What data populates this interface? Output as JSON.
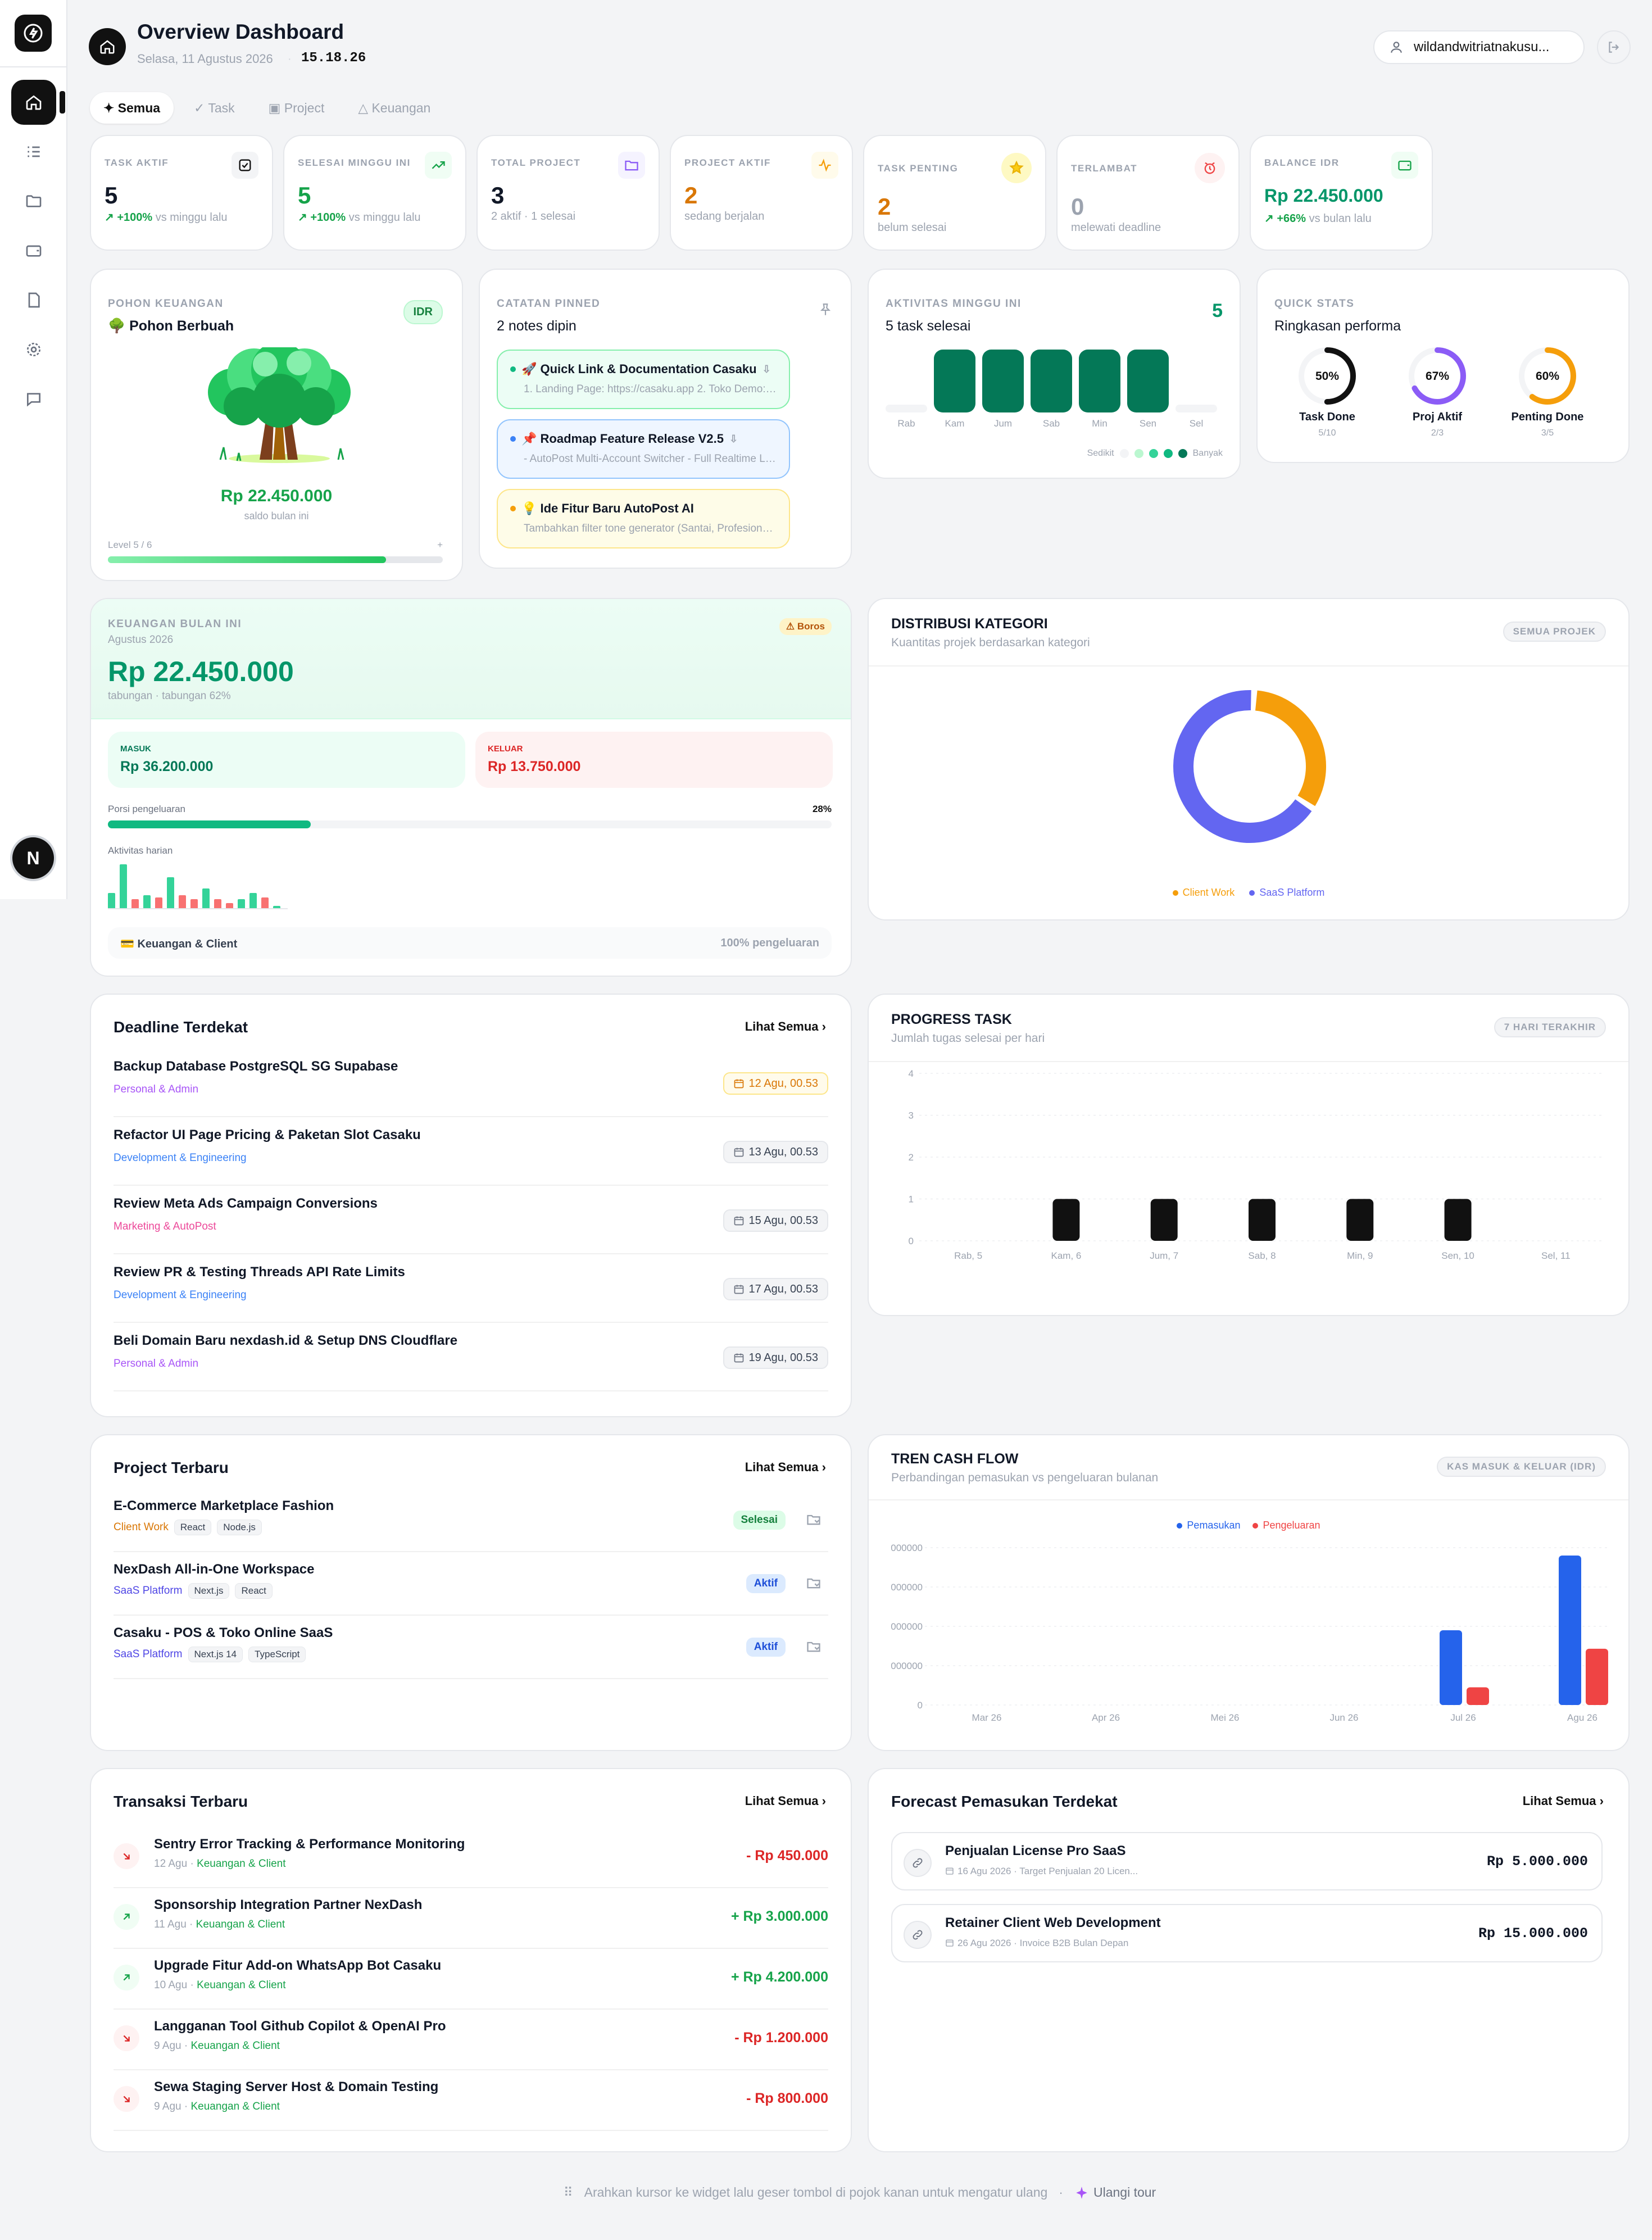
{
  "header": {
    "title": "Overview Dashboard",
    "date": "Selasa, 11 Agustus 2026",
    "time": "15.18.26",
    "user": "wildandwitriatnakusu..."
  },
  "tabs": [
    {
      "label": "✦ Semua"
    },
    {
      "label": "✓ Task"
    },
    {
      "label": "▣ Project"
    },
    {
      "label": "△ Keuangan"
    }
  ],
  "sidebar": {
    "avatar_letter": "N",
    "icons": [
      "home-icon",
      "list-icon",
      "folder-icon",
      "wallet-icon",
      "file-icon",
      "settings-icon",
      "chat-icon"
    ]
  },
  "stats": [
    {
      "label": "TASK AKTIF",
      "value": "5",
      "trend": "+100%",
      "sub": "vs minggu lalu",
      "color": "#111827"
    },
    {
      "label": "SELESAI MINGGU INI",
      "value": "5",
      "trend": "+100%",
      "sub": "vs minggu lalu",
      "color": "#16a34a"
    },
    {
      "label": "TOTAL PROJECT",
      "value": "3",
      "trend": "",
      "sub": "2 aktif · 1 selesai",
      "color": "#111827"
    },
    {
      "label": "PROJECT AKTIF",
      "value": "2",
      "trend": "",
      "sub": "sedang berjalan",
      "color": "#d97706"
    },
    {
      "label": "TASK PENTING",
      "value": "2",
      "trend": "",
      "sub": "belum selesai",
      "color": "#d97706"
    },
    {
      "label": "TERLAMBAT",
      "value": "0",
      "trend": "",
      "sub": "melewati deadline",
      "color": "#9ca3af"
    },
    {
      "label": "BALANCE IDR",
      "value": "Rp 22.450.000",
      "trend": "+66%",
      "sub": "vs bulan lalu",
      "color": "#059669"
    }
  ],
  "tree": {
    "label": "POHON KEUANGAN",
    "title": "🌳 Pohon Berbuah",
    "badge": "IDR",
    "amount": "Rp 22.450.000",
    "caption": "saldo bulan ini",
    "level": "Level 5 / 6",
    "level_pct": 0.83,
    "plus": "+"
  },
  "notes": {
    "label": "CATATAN PINNED",
    "title": "2 notes dipin",
    "items": [
      {
        "title": "🚀 Quick Link & Documentation Casaku",
        "desc": "1. Landing Page: https://casaku.app 2. Toko Demo: ..."
      },
      {
        "title": "📌 Roadmap Feature Release V2.5",
        "desc": "- AutoPost Multi-Account Switcher - Full Realtime Liv..."
      },
      {
        "title": "💡 Ide Fitur Baru AutoPost AI",
        "desc": "Tambahkan filter tone generator (Santai, Profesional, ..."
      }
    ]
  },
  "activity": {
    "label": "AKTIVITAS MINGGU INI",
    "title": "5 task selesai",
    "count": "5",
    "days": [
      {
        "label": "Rab",
        "value": 0
      },
      {
        "label": "Kam",
        "value": 1
      },
      {
        "label": "Jum",
        "value": 1
      },
      {
        "label": "Sab",
        "value": 1
      },
      {
        "label": "Min",
        "value": 1
      },
      {
        "label": "Sen",
        "value": 1
      },
      {
        "label": "Sel",
        "value": 0
      }
    ],
    "legend_low": "Sedikit",
    "legend_high": "Banyak"
  },
  "quick": {
    "label": "QUICK STATS",
    "title": "Ringkasan performa",
    "items": [
      {
        "pct": "50%",
        "value": 0.5,
        "label": "Task Done",
        "sub": "5/10",
        "color": "#111111"
      },
      {
        "pct": "67%",
        "value": 0.67,
        "label": "Proj Aktif",
        "sub": "2/3",
        "color": "#8b5cf6"
      },
      {
        "pct": "60%",
        "value": 0.6,
        "label": "Penting Done",
        "sub": "3/5",
        "color": "#f59e0b"
      }
    ]
  },
  "finance": {
    "label": "KEUANGAN BULAN INI",
    "month": "Agustus 2026",
    "badge": "⚠ Boros",
    "amount": "Rp 22.450.000",
    "sub": "tabungan · tabungan 62%",
    "in_label": "MASUK",
    "in_value": "Rp 36.200.000",
    "out_label": "KELUAR",
    "out_value": "Rp 13.750.000",
    "ratio_label": "Porsi pengeluaran",
    "ratio_pct": "28%",
    "ratio": 0.28,
    "daily_label": "Aktivitas harian",
    "daily": [
      {
        "v": 0.35,
        "t": "in"
      },
      {
        "v": 1,
        "t": "in"
      },
      {
        "v": 0.2,
        "t": "out"
      },
      {
        "v": 0.3,
        "t": "in"
      },
      {
        "v": 0.25,
        "t": "out"
      },
      {
        "v": 0.7,
        "t": "in"
      },
      {
        "v": 0.3,
        "t": "out"
      },
      {
        "v": 0.2,
        "t": "out"
      },
      {
        "v": 0.45,
        "t": "in"
      },
      {
        "v": 0.2,
        "t": "out"
      },
      {
        "v": 0.12,
        "t": "out"
      },
      {
        "v": 0.2,
        "t": "in"
      },
      {
        "v": 0.35,
        "t": "in"
      },
      {
        "v": 0.25,
        "t": "out"
      },
      {
        "v": 0.05,
        "t": "in"
      }
    ],
    "footer_left": "💳 Keuangan & Client",
    "footer_right": "100% pengeluaran"
  },
  "distribusi": {
    "title": "DISTRIBUSI KATEGORI",
    "subtitle": "Kuantitas projek berdasarkan kategori",
    "pill": "SEMUA PROJEK",
    "chart_data": {
      "type": "pie",
      "categories": [
        "Client Work",
        "SaaS Platform"
      ],
      "values": [
        1,
        2
      ],
      "colors": [
        "#f59e0b",
        "#6366f1"
      ]
    }
  },
  "deadline": {
    "title": "Deadline Terdekat",
    "link": "Lihat Semua",
    "items": [
      {
        "title": "Backup Database PostgreSQL SG Supabase",
        "cat": "Personal & Admin",
        "color": "#a855f7",
        "date": "12 Agu, 00.53",
        "urgent": true
      },
      {
        "title": "Refactor UI Page Pricing & Paketan Slot Casaku",
        "cat": "Development & Engineering",
        "color": "#3b82f6",
        "date": "13 Agu, 00.53",
        "urgent": false
      },
      {
        "title": "Review Meta Ads Campaign Conversions",
        "cat": "Marketing & AutoPost",
        "color": "#ec4899",
        "date": "15 Agu, 00.53",
        "urgent": false
      },
      {
        "title": "Review PR & Testing Threads API Rate Limits",
        "cat": "Development & Engineering",
        "color": "#3b82f6",
        "date": "17 Agu, 00.53",
        "urgent": false
      },
      {
        "title": "Beli Domain Baru nexdash.id & Setup DNS Cloudflare",
        "cat": "Personal & Admin",
        "color": "#a855f7",
        "date": "19 Agu, 00.53",
        "urgent": false
      }
    ]
  },
  "progress": {
    "title": "PROGRESS TASK",
    "subtitle": "Jumlah tugas selesai per hari",
    "pill": "7 HARI TERAKHIR",
    "chart_data": {
      "type": "bar",
      "categories": [
        "Rab, 5",
        "Kam, 6",
        "Jum, 7",
        "Sab, 8",
        "Min, 9",
        "Sen, 10",
        "Sel, 11"
      ],
      "values": [
        0,
        1,
        1,
        1,
        1,
        1,
        0
      ],
      "ylim": [
        0,
        4
      ],
      "yticks": [
        "0",
        "1",
        "2",
        "3",
        "4"
      ]
    }
  },
  "projects": {
    "title": "Project Terbaru",
    "link": "Lihat Semua",
    "items": [
      {
        "title": "E-Commerce Marketplace Fashion",
        "cat": "Client Work",
        "cat_color": "#d97706",
        "tags": [
          "React",
          "Node.js"
        ],
        "status": "Selesai",
        "status_bg": "#dcfce7",
        "status_color": "#15803d"
      },
      {
        "title": "NexDash All-in-One Workspace",
        "cat": "SaaS Platform",
        "cat_color": "#4f46e5",
        "tags": [
          "Next.js",
          "React"
        ],
        "status": "Aktif",
        "status_bg": "#dbeafe",
        "status_color": "#1d4ed8"
      },
      {
        "title": "Casaku - POS & Toko Online SaaS",
        "cat": "SaaS Platform",
        "cat_color": "#4f46e5",
        "tags": [
          "Next.js 14",
          "TypeScript"
        ],
        "status": "Aktif",
        "status_bg": "#dbeafe",
        "status_color": "#1d4ed8"
      }
    ]
  },
  "cashflow": {
    "title": "TREN CASH FLOW",
    "subtitle": "Perbandingan pemasukan vs pengeluaran bulanan",
    "pill": "KAS MASUK & KELUAR (IDR)",
    "chart_data": {
      "type": "bar",
      "categories": [
        "Mar 26",
        "Apr 26",
        "Mei 26",
        "Jun 26",
        "Jul 26",
        "Agu 26"
      ],
      "series": [
        {
          "name": "Pemasukan",
          "color": "#2563eb",
          "values": [
            0,
            0,
            0,
            0,
            19000000,
            38000000
          ]
        },
        {
          "name": "Pengeluaran",
          "color": "#ef4444",
          "values": [
            0,
            0,
            0,
            0,
            4500000,
            14300000
          ]
        }
      ],
      "ylim": [
        0,
        40000000
      ],
      "yticks": [
        "0",
        "000000",
        "000000",
        "000000",
        "000000"
      ]
    }
  },
  "transactions": {
    "title": "Transaksi Terbaru",
    "link": "Lihat Semua",
    "items": [
      {
        "title": "Sentry Error Tracking & Performance Monitoring",
        "date": "12 Agu",
        "cat": "Keuangan & Client",
        "amount": "- Rp 450.000",
        "type": "out"
      },
      {
        "title": "Sponsorship Integration Partner NexDash",
        "date": "11 Agu",
        "cat": "Keuangan & Client",
        "amount": "+ Rp 3.000.000",
        "type": "in"
      },
      {
        "title": "Upgrade Fitur Add-on WhatsApp Bot Casaku",
        "date": "10 Agu",
        "cat": "Keuangan & Client",
        "amount": "+ Rp 4.200.000",
        "type": "in"
      },
      {
        "title": "Langganan Tool Github Copilot & OpenAI Pro",
        "date": "9 Agu",
        "cat": "Keuangan & Client",
        "amount": "- Rp 1.200.000",
        "type": "out"
      },
      {
        "title": "Sewa Staging Server Host & Domain Testing",
        "date": "9 Agu",
        "cat": "Keuangan & Client",
        "amount": "- Rp 800.000",
        "type": "out"
      }
    ]
  },
  "forecast": {
    "title": "Forecast Pemasukan Terdekat",
    "link": "Lihat Semua",
    "items": [
      {
        "title": "Penjualan License Pro SaaS",
        "date": "16 Agu 2026",
        "desc": "Target Penjualan 20 Licen...",
        "amount": "Rp 5.000.000"
      },
      {
        "title": "Retainer Client Web Development",
        "date": "26 Agu 2026",
        "desc": "Invoice B2B Bulan Depan",
        "amount": "Rp 15.000.000"
      }
    ]
  },
  "footer": {
    "hint": "Arahkan kursor ke widget lalu geser tombol di pojok kanan untuk mengatur ulang",
    "tour": "Ulangi tour"
  }
}
